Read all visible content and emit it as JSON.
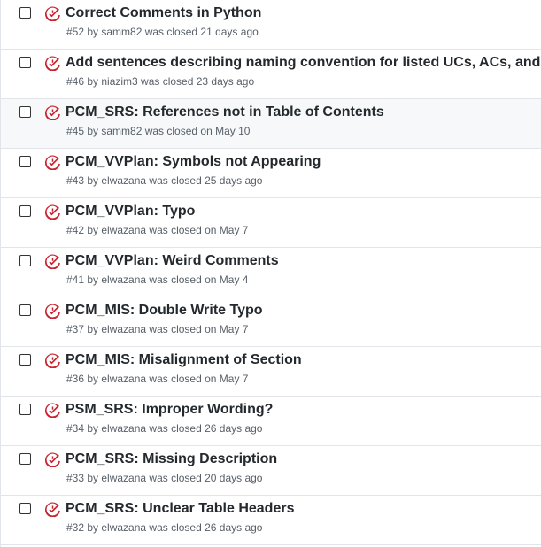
{
  "colors": {
    "closed_icon": "#cb2431",
    "title": "#24292e",
    "meta": "#586069",
    "hover_row": "#f6f8fa",
    "border": "#e1e4e8"
  },
  "issues": [
    {
      "title": "Correct Comments in Python",
      "meta": "#52 by samm82 was closed 21 days ago",
      "icon": "issue-closed-icon"
    },
    {
      "title": "Add sentences describing naming convention for listed UCs, ACs, and Ms",
      "meta": "#46 by niazim3 was closed 23 days ago",
      "icon": "issue-closed-icon"
    },
    {
      "title": "PCM_SRS: References not in Table of Contents",
      "meta": "#45 by samm82 was closed on May 10",
      "icon": "issue-closed-icon"
    },
    {
      "title": "PCM_VVPlan: Symbols not Appearing",
      "meta": "#43 by elwazana was closed 25 days ago",
      "icon": "issue-closed-icon"
    },
    {
      "title": "PCM_VVPlan: Typo",
      "meta": "#42 by elwazana was closed on May 7",
      "icon": "issue-closed-icon"
    },
    {
      "title": "PCM_VVPlan: Weird Comments",
      "meta": "#41 by elwazana was closed on May 4",
      "icon": "issue-closed-icon"
    },
    {
      "title": "PCM_MIS: Double Write Typo",
      "meta": "#37 by elwazana was closed on May 7",
      "icon": "issue-closed-icon"
    },
    {
      "title": "PCM_MIS: Misalignment of Section",
      "meta": "#36 by elwazana was closed on May 7",
      "icon": "issue-closed-icon"
    },
    {
      "title": "PSM_SRS: Improper Wording?",
      "meta": "#34 by elwazana was closed 26 days ago",
      "icon": "issue-closed-icon"
    },
    {
      "title": "PCM_SRS: Missing Description",
      "meta": "#33 by elwazana was closed 20 days ago",
      "icon": "issue-closed-icon"
    },
    {
      "title": "PCM_SRS: Unclear Table Headers",
      "meta": "#32 by elwazana was closed 26 days ago",
      "icon": "issue-closed-icon"
    }
  ]
}
